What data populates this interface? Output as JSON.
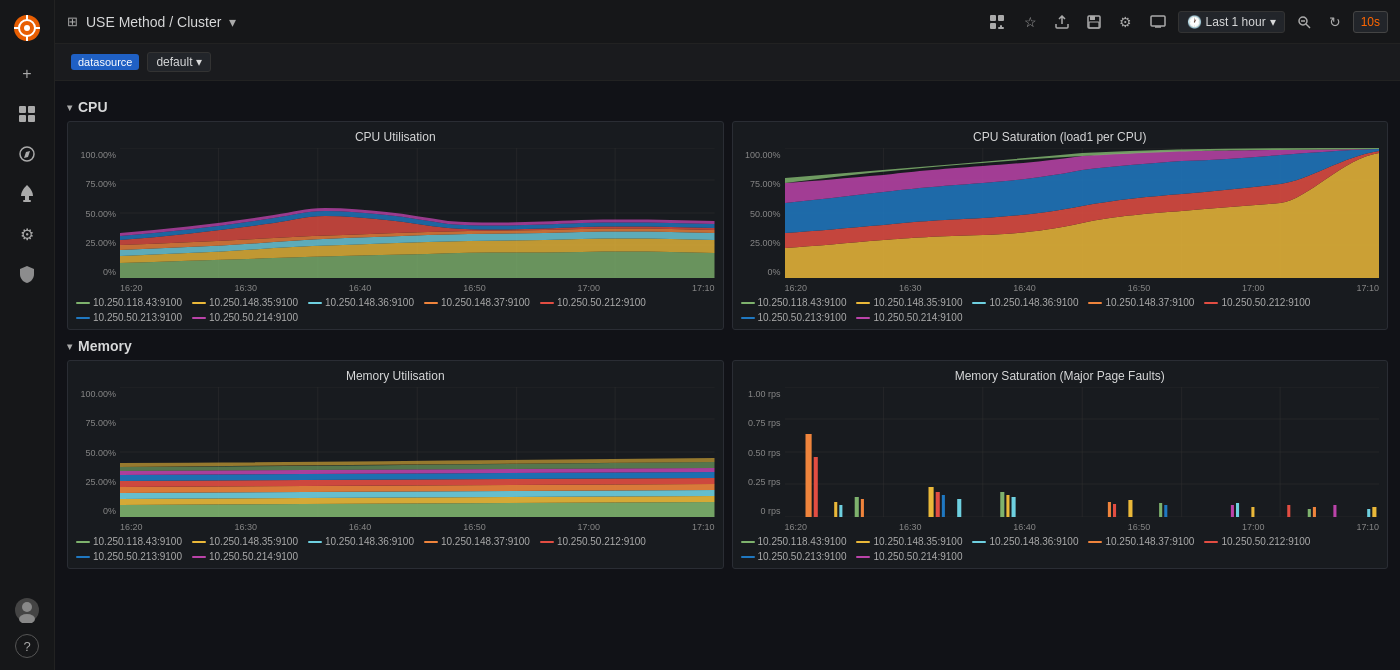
{
  "sidebar": {
    "logo_color": "#f60",
    "items": [
      {
        "name": "plus-icon",
        "icon": "+",
        "label": "Add",
        "active": false
      },
      {
        "name": "dashboard-icon",
        "icon": "⊞",
        "label": "Dashboards",
        "active": false
      },
      {
        "name": "explore-icon",
        "icon": "✦",
        "label": "Explore",
        "active": false
      },
      {
        "name": "alerting-icon",
        "icon": "🔔",
        "label": "Alerting",
        "active": false
      },
      {
        "name": "settings-icon",
        "icon": "⚙",
        "label": "Settings",
        "active": false
      },
      {
        "name": "shield-icon",
        "icon": "🛡",
        "label": "Shield",
        "active": false
      }
    ],
    "bottom_items": [
      {
        "name": "user-icon",
        "icon": "👤",
        "label": "User"
      },
      {
        "name": "help-icon",
        "icon": "?",
        "label": "Help"
      }
    ]
  },
  "topbar": {
    "title": "USE Method / Cluster",
    "buttons": [
      {
        "name": "add-panel-btn",
        "icon": "📊",
        "label": "Add panel"
      },
      {
        "name": "star-btn",
        "icon": "☆",
        "label": "Star"
      },
      {
        "name": "share-btn",
        "icon": "↑",
        "label": "Share"
      },
      {
        "name": "save-btn",
        "icon": "💾",
        "label": "Save"
      },
      {
        "name": "settings-btn",
        "icon": "⚙",
        "label": "Settings"
      },
      {
        "name": "display-btn",
        "icon": "🖥",
        "label": "Display"
      }
    ],
    "time_picker": {
      "icon": "🕐",
      "label": "Last 1 hour",
      "has_dropdown": true
    },
    "zoom_btn": {
      "icon": "🔍"
    },
    "refresh_btn": {
      "icon": "↻"
    },
    "refresh_interval": "10s"
  },
  "filters": {
    "datasource_label": "datasource",
    "datasource_value": "default"
  },
  "sections": [
    {
      "name": "cpu",
      "label": "CPU",
      "panels": [
        {
          "name": "cpu-utilisation",
          "title": "CPU Utilisation",
          "y_axis": [
            "100.00%",
            "75.00%",
            "50.00%",
            "25.00%",
            "0%"
          ],
          "x_axis": [
            "16:20",
            "16:30",
            "16:40",
            "16:50",
            "17:00",
            "17:10"
          ],
          "type": "stacked_area",
          "style": "low"
        },
        {
          "name": "cpu-saturation",
          "title": "CPU Saturation (load1 per CPU)",
          "y_axis": [
            "100.00%",
            "75.00%",
            "50.00%",
            "25.00%",
            "0%"
          ],
          "x_axis": [
            "16:20",
            "16:30",
            "16:40",
            "16:50",
            "17:00",
            "17:10"
          ],
          "type": "stacked_area",
          "style": "high"
        }
      ],
      "legend_items": [
        {
          "color": "#7eb26d",
          "label": "10.250.118.43:9100"
        },
        {
          "color": "#eab839",
          "label": "10.250.148.35:9100"
        },
        {
          "color": "#6ed0e0",
          "label": "10.250.148.36:9100"
        },
        {
          "color": "#ef843c",
          "label": "10.250.148.37:9100"
        },
        {
          "color": "#e24d42",
          "label": "10.250.50.212:9100"
        },
        {
          "color": "#1f78c1",
          "label": "10.250.50.213:9100"
        },
        {
          "color": "#ba43a9",
          "label": "10.250.50.214:9100"
        }
      ]
    },
    {
      "name": "memory",
      "label": "Memory",
      "panels": [
        {
          "name": "memory-utilisation",
          "title": "Memory Utilisation",
          "y_axis": [
            "100.00%",
            "75.00%",
            "50.00%",
            "25.00%",
            "0%"
          ],
          "x_axis": [
            "16:20",
            "16:30",
            "16:40",
            "16:50",
            "17:00",
            "17:10"
          ],
          "type": "stacked_area",
          "style": "memory"
        },
        {
          "name": "memory-saturation",
          "title": "Memory Saturation (Major Page Faults)",
          "y_axis": [
            "1.00 rps",
            "0.75 rps",
            "0.50 rps",
            "0.25 rps",
            "0 rps"
          ],
          "x_axis": [
            "16:20",
            "16:30",
            "16:40",
            "16:50",
            "17:00",
            "17:10"
          ],
          "type": "bar",
          "style": "spikes"
        }
      ],
      "legend_items": [
        {
          "color": "#7eb26d",
          "label": "10.250.118.43:9100"
        },
        {
          "color": "#eab839",
          "label": "10.250.148.35:9100"
        },
        {
          "color": "#6ed0e0",
          "label": "10.250.148.36:9100"
        },
        {
          "color": "#ef843c",
          "label": "10.250.148.37:9100"
        },
        {
          "color": "#e24d42",
          "label": "10.250.50.212:9100"
        },
        {
          "color": "#1f78c1",
          "label": "10.250.50.213:9100"
        },
        {
          "color": "#ba43a9",
          "label": "10.250.50.214:9100"
        }
      ]
    }
  ]
}
